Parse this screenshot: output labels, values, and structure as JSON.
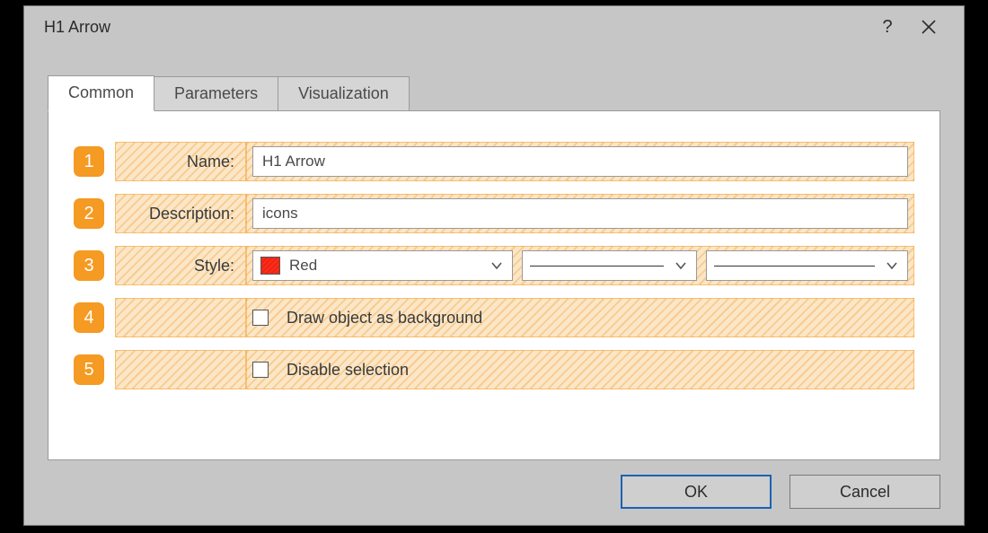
{
  "window": {
    "title": "H1 Arrow"
  },
  "tabs": [
    {
      "label": "Common",
      "active": true
    },
    {
      "label": "Parameters",
      "active": false
    },
    {
      "label": "Visualization",
      "active": false
    }
  ],
  "rows": {
    "r1": {
      "num": "1",
      "label": "Name:",
      "value": "H1 Arrow"
    },
    "r2": {
      "num": "2",
      "label": "Description:",
      "value": "icons"
    },
    "r3": {
      "num": "3",
      "label": "Style:",
      "color_name": "Red"
    },
    "r4": {
      "num": "4",
      "checkbox_label": "Draw object as background"
    },
    "r5": {
      "num": "5",
      "checkbox_label": "Disable selection"
    }
  },
  "footer": {
    "ok": "OK",
    "cancel": "Cancel"
  },
  "colors": {
    "accent": "#f59a22",
    "swatch": "#ff2a17"
  }
}
